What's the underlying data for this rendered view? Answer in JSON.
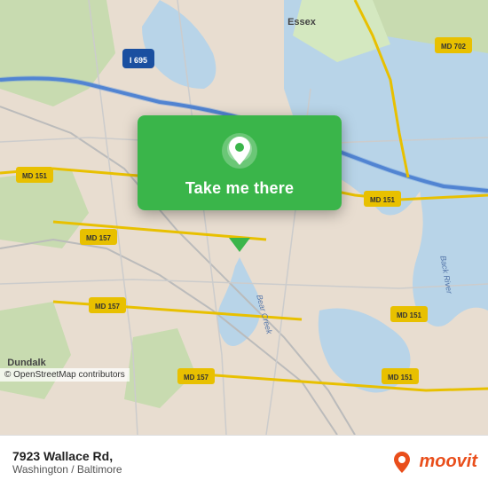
{
  "map": {
    "attribution": "© OpenStreetMap contributors",
    "bg_color": "#e8ddd0"
  },
  "popup": {
    "button_label": "Take me there",
    "bg_color": "#3ab54a"
  },
  "bottom_bar": {
    "address": "7923 Wallace Rd,",
    "city": "Washington / Baltimore"
  },
  "moovit": {
    "text": "moovit"
  },
  "roads": [
    {
      "label": "I 695",
      "color": "#3a7bd5"
    },
    {
      "label": "MD 151",
      "color": "#c8b400"
    },
    {
      "label": "MD 157",
      "color": "#c8b400"
    },
    {
      "label": "MD 702",
      "color": "#c8b400"
    },
    {
      "label": "ESSEX",
      "color": "#555"
    },
    {
      "label": "Dundalk",
      "color": "#555"
    },
    {
      "label": "Back River",
      "color": "#5594c4"
    },
    {
      "label": "Bear Creek",
      "color": "#5594c4"
    }
  ]
}
